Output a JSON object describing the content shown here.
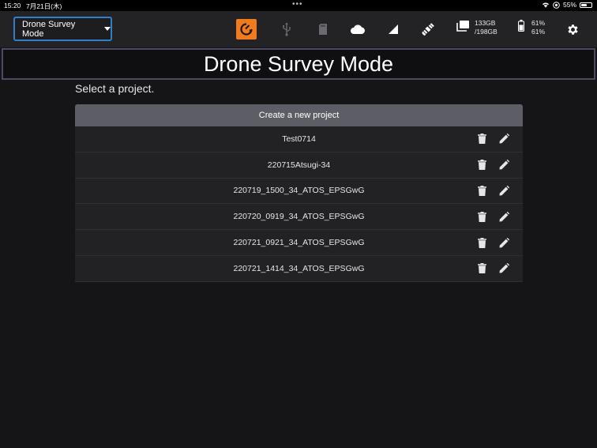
{
  "status_bar": {
    "time": "15:20",
    "date": "7月21日(木)",
    "battery_percent": "55%",
    "battery_level": 0.55,
    "icons": [
      "wifi-icon",
      "location-icon",
      "battery-icon"
    ]
  },
  "toolbar": {
    "mode_select_value": "Drone Survey Mode",
    "icons": [
      "drone-connection-icon",
      "usb-icon",
      "sd-card-icon",
      "cloud-icon",
      "signal-icon",
      "satellite-icon",
      "storage-icon",
      "battery-icon",
      "gear-icon"
    ],
    "storage_used": "133GB",
    "storage_total": "/198GB",
    "battery_1": "61%",
    "battery_2": "61%",
    "accent_color": "#f07a1c",
    "select_border_color": "#2f7fc9"
  },
  "page": {
    "title": "Drone Survey Mode",
    "prompt": "Select a project."
  },
  "projects": {
    "create_label": "Create a new project",
    "items": [
      {
        "name": "Test0714"
      },
      {
        "name": "220715Atsugi-34"
      },
      {
        "name": "220719_1500_34_ATOS_EPSGwG"
      },
      {
        "name": "220720_0919_34_ATOS_EPSGwG"
      },
      {
        "name": "220721_0921_34_ATOS_EPSGwG"
      },
      {
        "name": "220721_1414_34_ATOS_EPSGwG"
      }
    ],
    "row_icons": [
      "trash-icon",
      "pencil-icon"
    ]
  }
}
